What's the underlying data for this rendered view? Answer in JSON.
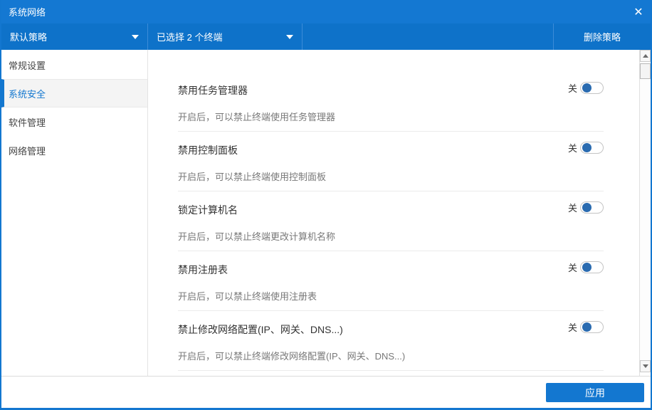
{
  "window": {
    "title": "系统网络",
    "close_glyph": "✕"
  },
  "toolbar": {
    "policy_dropdown": {
      "value": "默认策略"
    },
    "terminal_dropdown": {
      "value": "已选择 2 个终端"
    },
    "delete_button_label": "删除策略"
  },
  "sidebar": {
    "items": [
      {
        "label": "常规设置",
        "selected": false
      },
      {
        "label": "系统安全",
        "selected": true
      },
      {
        "label": "软件管理",
        "selected": false
      },
      {
        "label": "网络管理",
        "selected": false
      }
    ]
  },
  "content": {
    "rows": [
      {
        "title": "禁用任务管理器",
        "description": "开启后，可以禁止终端使用任务管理器",
        "toggle_label": "关",
        "toggle_state": "off"
      },
      {
        "title": "禁用控制面板",
        "description": "开启后，可以禁止终端使用控制面板",
        "toggle_label": "关",
        "toggle_state": "off"
      },
      {
        "title": "锁定计算机名",
        "description": "开启后，可以禁止终端更改计算机名称",
        "toggle_label": "关",
        "toggle_state": "off"
      },
      {
        "title": "禁用注册表",
        "description": "开启后，可以禁止终端使用注册表",
        "toggle_label": "关",
        "toggle_state": "off"
      },
      {
        "title": "禁止修改网络配置(IP、网关、DNS...)",
        "description": "开启后，可以禁止终端修改网络配置(IP、网关、DNS...)",
        "toggle_label": "关",
        "toggle_state": "off"
      }
    ]
  },
  "footer": {
    "apply_button_label": "应用"
  },
  "colors": {
    "titlebar": "#1478d2",
    "toolbar": "#0e72c9",
    "accent": "#1377d0",
    "toggle_knob": "#2a6bb0"
  }
}
